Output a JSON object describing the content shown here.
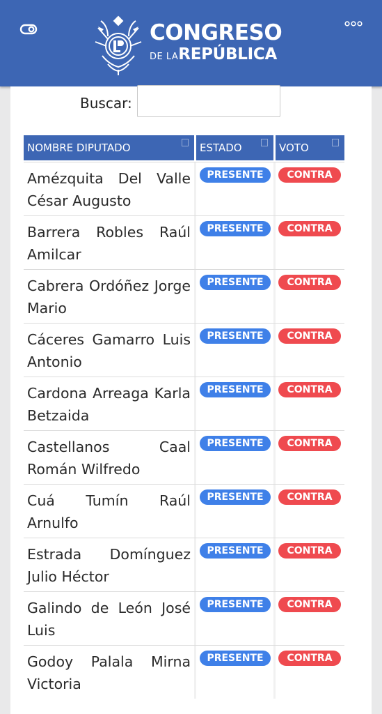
{
  "header": {
    "logo_line1": "CONGRESO",
    "logo_line2_small": "DE LA",
    "logo_line2_big": "REPÚBLICA",
    "bg_color": "#3d66b4",
    "icons": {
      "left": "toggle-icon",
      "right": "more-dots-icon",
      "emblem": "coat-of-arms-icon"
    }
  },
  "search": {
    "label": "Buscar:",
    "value": "",
    "placeholder": ""
  },
  "table": {
    "columns": [
      "NOMBRE DIPUTADO",
      "ESTADO",
      "VOTO"
    ],
    "rows": [
      {
        "name": "Amézquita Del Valle César Augusto",
        "estado": "PRESENTE",
        "voto": "CONTRA"
      },
      {
        "name": "Barrera Robles Raúl Amilcar",
        "estado": "PRESENTE",
        "voto": "CONTRA"
      },
      {
        "name": "Cabrera Ordóñez Jorge Mario",
        "estado": "PRESENTE",
        "voto": "CONTRA"
      },
      {
        "name": "Cáceres Gamarro Luis Antonio",
        "estado": "PRESENTE",
        "voto": "CONTRA"
      },
      {
        "name": "Cardona Arreaga Karla Betzaida",
        "estado": "PRESENTE",
        "voto": "CONTRA"
      },
      {
        "name": "Castellanos Caal Román Wilfredo",
        "estado": "PRESENTE",
        "voto": "CONTRA"
      },
      {
        "name": "Cuá Tumín Raúl Arnulfo",
        "estado": "PRESENTE",
        "voto": "CONTRA"
      },
      {
        "name": "Estrada Domínguez Julio Héctor",
        "estado": "PRESENTE",
        "voto": "CONTRA"
      },
      {
        "name": "Galindo de León José Luis",
        "estado": "PRESENTE",
        "voto": "CONTRA"
      },
      {
        "name": "Godoy Palala Mirna Victoria",
        "estado": "PRESENTE",
        "voto": "CONTRA"
      }
    ],
    "colors": {
      "presente": "#3f80e8",
      "contra": "#ef4a4f",
      "header": "#3d66b4"
    }
  }
}
